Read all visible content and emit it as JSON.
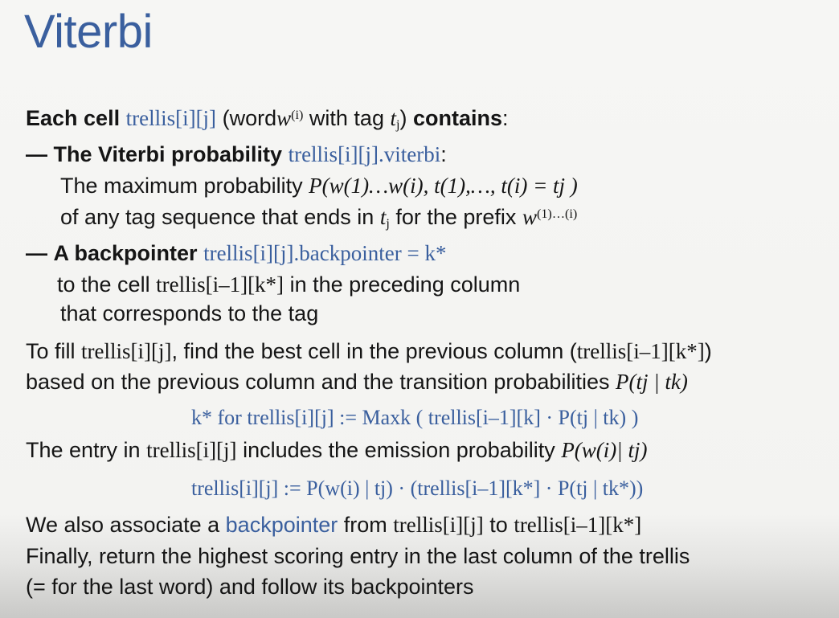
{
  "slide": {
    "title": "Viterbi"
  },
  "text": {
    "l1_a": "Each cell",
    "l1_b": "trellis[i][j]",
    "l1_c": "(word",
    "l1_w": "w",
    "l1_wsup": "(i)",
    "l1_d": "with tag",
    "l1_t": "t",
    "l1_tsub": "j",
    "l1_e": ")",
    "l1_f": "contains",
    "l1_g": ":",
    "l2_dash": "—",
    "l2_a": "The Viterbi probability",
    "l2_b": "trellis[i][j].viterbi",
    "l2_c": ":",
    "l3_a": "The maximum probability",
    "l3_formula": "P(w(1)…w(i), t(1),…, t(i) = tj )",
    "l4_a": "of any tag sequence that ends in",
    "l4_t": "t",
    "l4_tsub": "j",
    "l4_b": "for the prefix",
    "l4_w": "w",
    "l4_wsup": "(1)…(i)",
    "l5_dash": "—",
    "l5_a": "A backpointer",
    "l5_b": "trellis[i][j].backpointer = k*",
    "l6_a": "to the cell",
    "l6_b": "trellis[i–1][k*]",
    "l6_c": "in the preceding column",
    "l7_a": "that corresponds to the tag",
    "l8_a": "To fill",
    "l8_b": "trellis[i][j]",
    "l8_c": ", find the best cell in the previous column (",
    "l8_d": "trellis[i–1][k*]",
    "l8_e": ")",
    "l9_a": "based on the previous column and the transition probabilities",
    "l9_formula": "P(tj | tk)",
    "l10_formula": "k* for trellis[i][j] :=  Maxk ( trellis[i–1][k] · P(tj | tk) )",
    "l11_a": "The entry in",
    "l11_b": "trellis[i][j]",
    "l11_c": "includes the emission probability",
    "l11_formula": "P(w(i)| tj)",
    "l12_formula": "trellis[i][j] :=  P(w(i) | tj) · (trellis[i–1][k*] · P(tj | tk*))",
    "l13_a": "We also associate a",
    "l13_b": "backpointer",
    "l13_c": "from",
    "l13_d": "trellis[i][j]",
    "l13_e": "to",
    "l13_f": "trellis[i–1][k*]",
    "l14_a": "Finally, return the highest scoring entry in the last column of the trellis",
    "l15_a": "(= for the last word) and follow its backpointers"
  }
}
